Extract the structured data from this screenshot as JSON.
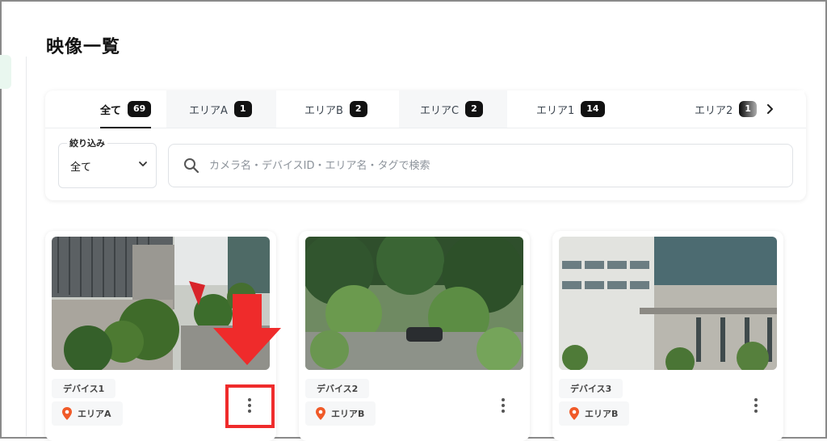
{
  "page": {
    "title": "映像一覧"
  },
  "tabs": [
    {
      "label": "全て",
      "count": "69"
    },
    {
      "label": "エリアA",
      "count": "1"
    },
    {
      "label": "エリアB",
      "count": "2"
    },
    {
      "label": "エリアC",
      "count": "2"
    },
    {
      "label": "エリア1",
      "count": "14"
    },
    {
      "label": "エリア2",
      "count": "1"
    }
  ],
  "filter": {
    "legend": "絞り込み",
    "value": "全て"
  },
  "search": {
    "placeholder": "カメラ名・デバイスID・エリア名・タグで検索"
  },
  "cards": [
    {
      "device": "デバイス1",
      "area": "エリアA"
    },
    {
      "device": "デバイス2",
      "area": "エリアB"
    },
    {
      "device": "デバイス3",
      "area": "エリアB"
    }
  ],
  "colors": {
    "badge": "#111111",
    "pin": "#f05a28",
    "highlight": "#ef2b2b"
  },
  "icons": [
    "search-icon",
    "chevron-down-icon",
    "chevron-right-icon",
    "more-vertical-icon",
    "location-pin-icon"
  ]
}
